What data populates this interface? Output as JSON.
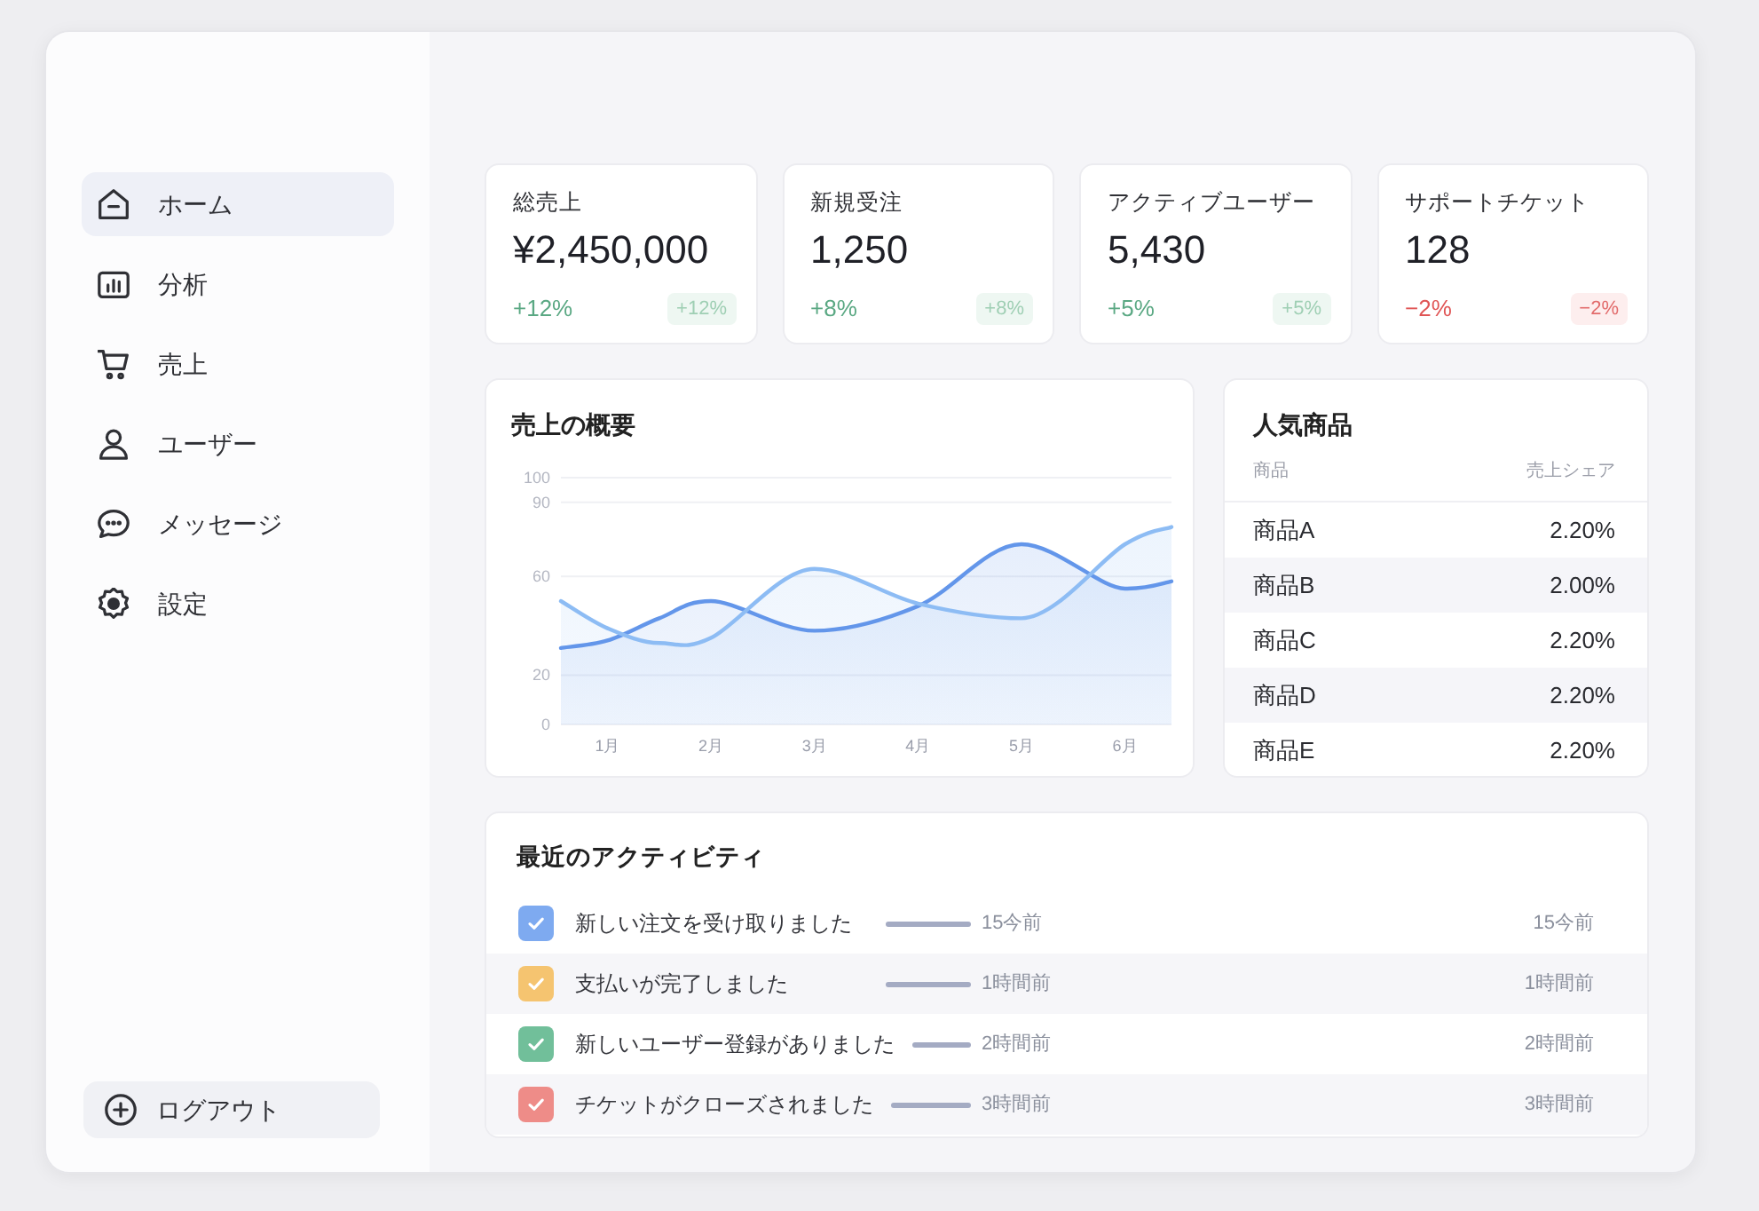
{
  "sidebar": {
    "items": [
      {
        "label": "ホーム",
        "selected": true
      },
      {
        "label": "分析",
        "selected": false
      },
      {
        "label": "売上",
        "selected": false
      },
      {
        "label": "ユーザー",
        "selected": false
      },
      {
        "label": "メッセージ",
        "selected": false
      },
      {
        "label": "設定",
        "selected": false
      }
    ],
    "logout": {
      "label": "ログアウト"
    }
  },
  "kpis": [
    {
      "title": "総売上",
      "value": "¥2,450,000",
      "change": "+12%",
      "badge": "+12%",
      "negative": false
    },
    {
      "title": "新規受注",
      "value": "1,250",
      "change": "+8%",
      "badge": "+8%",
      "negative": false
    },
    {
      "title": "アクティブユーザー",
      "value": "5,430",
      "change": "+5%",
      "badge": "+5%",
      "negative": false
    },
    {
      "title": "サポートチケット",
      "value": "128",
      "change": "−2%",
      "badge": "−2%",
      "negative": true
    }
  ],
  "sales_overview": {
    "title": "売上の概要",
    "chart_data": {
      "type": "area",
      "x": [
        0.55,
        1,
        1.5,
        2,
        3,
        4,
        5,
        6,
        6.45
      ],
      "xlim": [
        0.55,
        6.45
      ],
      "xticks": [
        {
          "value": 1,
          "label": "1月"
        },
        {
          "value": 2,
          "label": "2月"
        },
        {
          "value": 3,
          "label": "3月"
        },
        {
          "value": 4,
          "label": "4月"
        },
        {
          "value": 5,
          "label": "5月"
        },
        {
          "value": 6,
          "label": "6月"
        }
      ],
      "ylim": [
        0,
        100
      ],
      "yticks": [
        0,
        20,
        60,
        90,
        100
      ],
      "grid": true,
      "series": [
        {
          "color": "#6396ea",
          "values": [
            31,
            34,
            43,
            50,
            38,
            48,
            73,
            55,
            58
          ]
        },
        {
          "color": "#8dbcf4",
          "values": [
            50,
            39,
            33,
            35,
            63,
            49,
            43,
            73,
            80
          ]
        }
      ]
    }
  },
  "popular_products": {
    "title": "人気商品",
    "columns": [
      "商品",
      "売上シェア"
    ],
    "rows": [
      {
        "product": "商品A",
        "share": "2.20%"
      },
      {
        "product": "商品B",
        "share": "2.00%"
      },
      {
        "product": "商品C",
        "share": "2.20%"
      },
      {
        "product": "商品D",
        "share": "2.20%"
      },
      {
        "product": "商品E",
        "share": "2.20%"
      }
    ]
  },
  "recent_activity": {
    "title": "最近のアクティビティ",
    "items": [
      {
        "text": "新しい注文を受け取りました",
        "time": "15今前",
        "time_right": "15今前",
        "color": "#7eaaf0"
      },
      {
        "text": "支払いが完了しました",
        "time": "1時間前",
        "time_right": "1時間前",
        "color": "#f5c470"
      },
      {
        "text": "新しいユーザー登録がありました",
        "time": "2時間前",
        "time_right": "2時間前",
        "color": "#71bf9a"
      },
      {
        "text": "チケットがクローズされました",
        "time": "3時間前",
        "time_right": "3時間前",
        "color": "#ee8c88"
      }
    ]
  }
}
